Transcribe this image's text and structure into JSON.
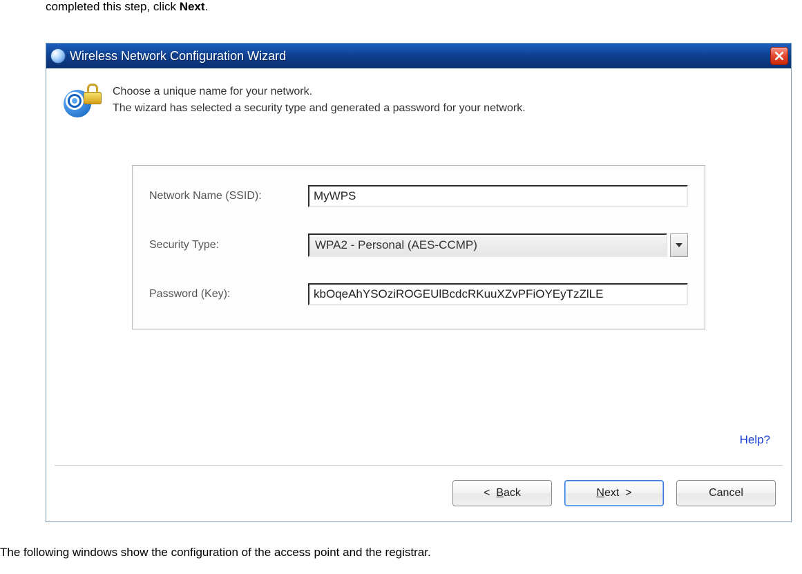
{
  "doc": {
    "top_fragment_prefix": "completed this step, click ",
    "top_fragment_bold": "Next",
    "top_fragment_suffix": ".",
    "bottom_text": "The following windows show the configuration of the access point and the registrar."
  },
  "dialog": {
    "title": "Wireless Network Configuration Wizard",
    "header_line1": "Choose a unique name for your network.",
    "header_line2": "The wizard has selected a security type and generated a password for your network.",
    "form": {
      "ssid_label": "Network Name (SSID):",
      "ssid_value": "MyWPS",
      "security_label": "Security Type:",
      "security_value": "WPA2 - Personal (AES-CCMP)",
      "password_label": "Password (Key):",
      "password_value": "kbOqeAhYSOziROGEUlBcdcRKuuXZvPFiOYEyTzZlLE"
    },
    "help_link": "Help?",
    "buttons": {
      "back_prefix": "<  ",
      "back_uchar": "B",
      "back_suffix": "ack",
      "next_uchar": "N",
      "next_suffix": "ext  >",
      "cancel": "Cancel"
    }
  }
}
